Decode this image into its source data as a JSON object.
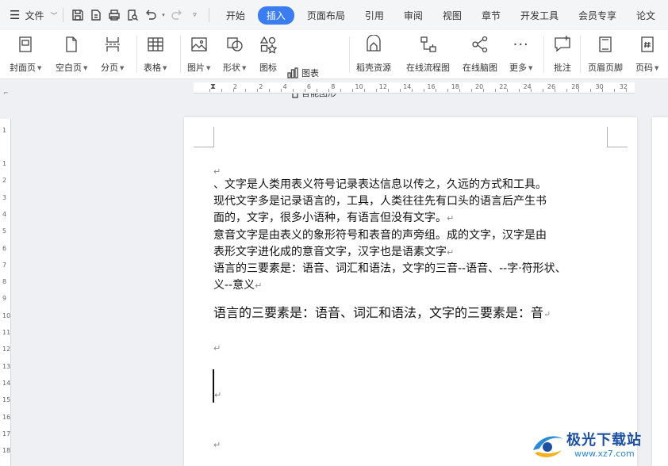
{
  "menu": {
    "file_label": "文件",
    "tabs": [
      {
        "label": "开始"
      },
      {
        "label": "插入"
      },
      {
        "label": "页面布局"
      },
      {
        "label": "引用"
      },
      {
        "label": "审阅"
      },
      {
        "label": "视图"
      },
      {
        "label": "章节"
      },
      {
        "label": "开发工具"
      },
      {
        "label": "会员专享"
      },
      {
        "label": "论文"
      }
    ],
    "active_tab": "插入"
  },
  "ribbon": {
    "cover_page": "封面页",
    "blank_page": "空白页",
    "page_break": "分页",
    "table": "表格",
    "picture": "图片",
    "shape": "形状",
    "icon": "图标",
    "chart": "图表",
    "smart_art": "智能图形",
    "docer_resources": "稻壳资源",
    "online_flowchart": "在线流程图",
    "online_mindmap": "在线脑图",
    "more": "更多",
    "comment": "批注",
    "header_footer": "页眉页脚",
    "page_number": "页码"
  },
  "ruler": {
    "h_numbers": [
      "2",
      "2",
      "4",
      "6",
      "8",
      "10",
      "12",
      "14",
      "16",
      "18",
      "20",
      "22",
      "24",
      "26",
      "28",
      "30",
      "32"
    ],
    "v_numbers": [
      "1",
      "1",
      "2",
      "3",
      "4",
      "5",
      "6",
      "7",
      "8",
      "9",
      "10",
      "11",
      "12",
      "13",
      "14",
      "15",
      "16",
      "17",
      "18"
    ]
  },
  "document": {
    "para_mark": "↵",
    "lines": [
      "、文字是人类用表义符号记录表达信息以传之，久远的方式和工具。",
      "现代文字多是记录语言的，工具，人类往往先有口头的语言后产生书",
      "面的，文字，很多小语种，有语言但没有文字。",
      "意音文字是由表义的象形符号和表音的声旁组。成的文字，汉字是由",
      "表形文字进化成的意音文字，汉字也是语素文字",
      "语言的三要素是：语音、词汇和语法，文字的三音--语音、--字·符形状、",
      "义--意义"
    ],
    "big_line": "语言的三要素是：语音、词汇和语法，文字的三要素是：音"
  },
  "watermark": {
    "name": "极光下载站",
    "url": "www.xz7.com"
  }
}
